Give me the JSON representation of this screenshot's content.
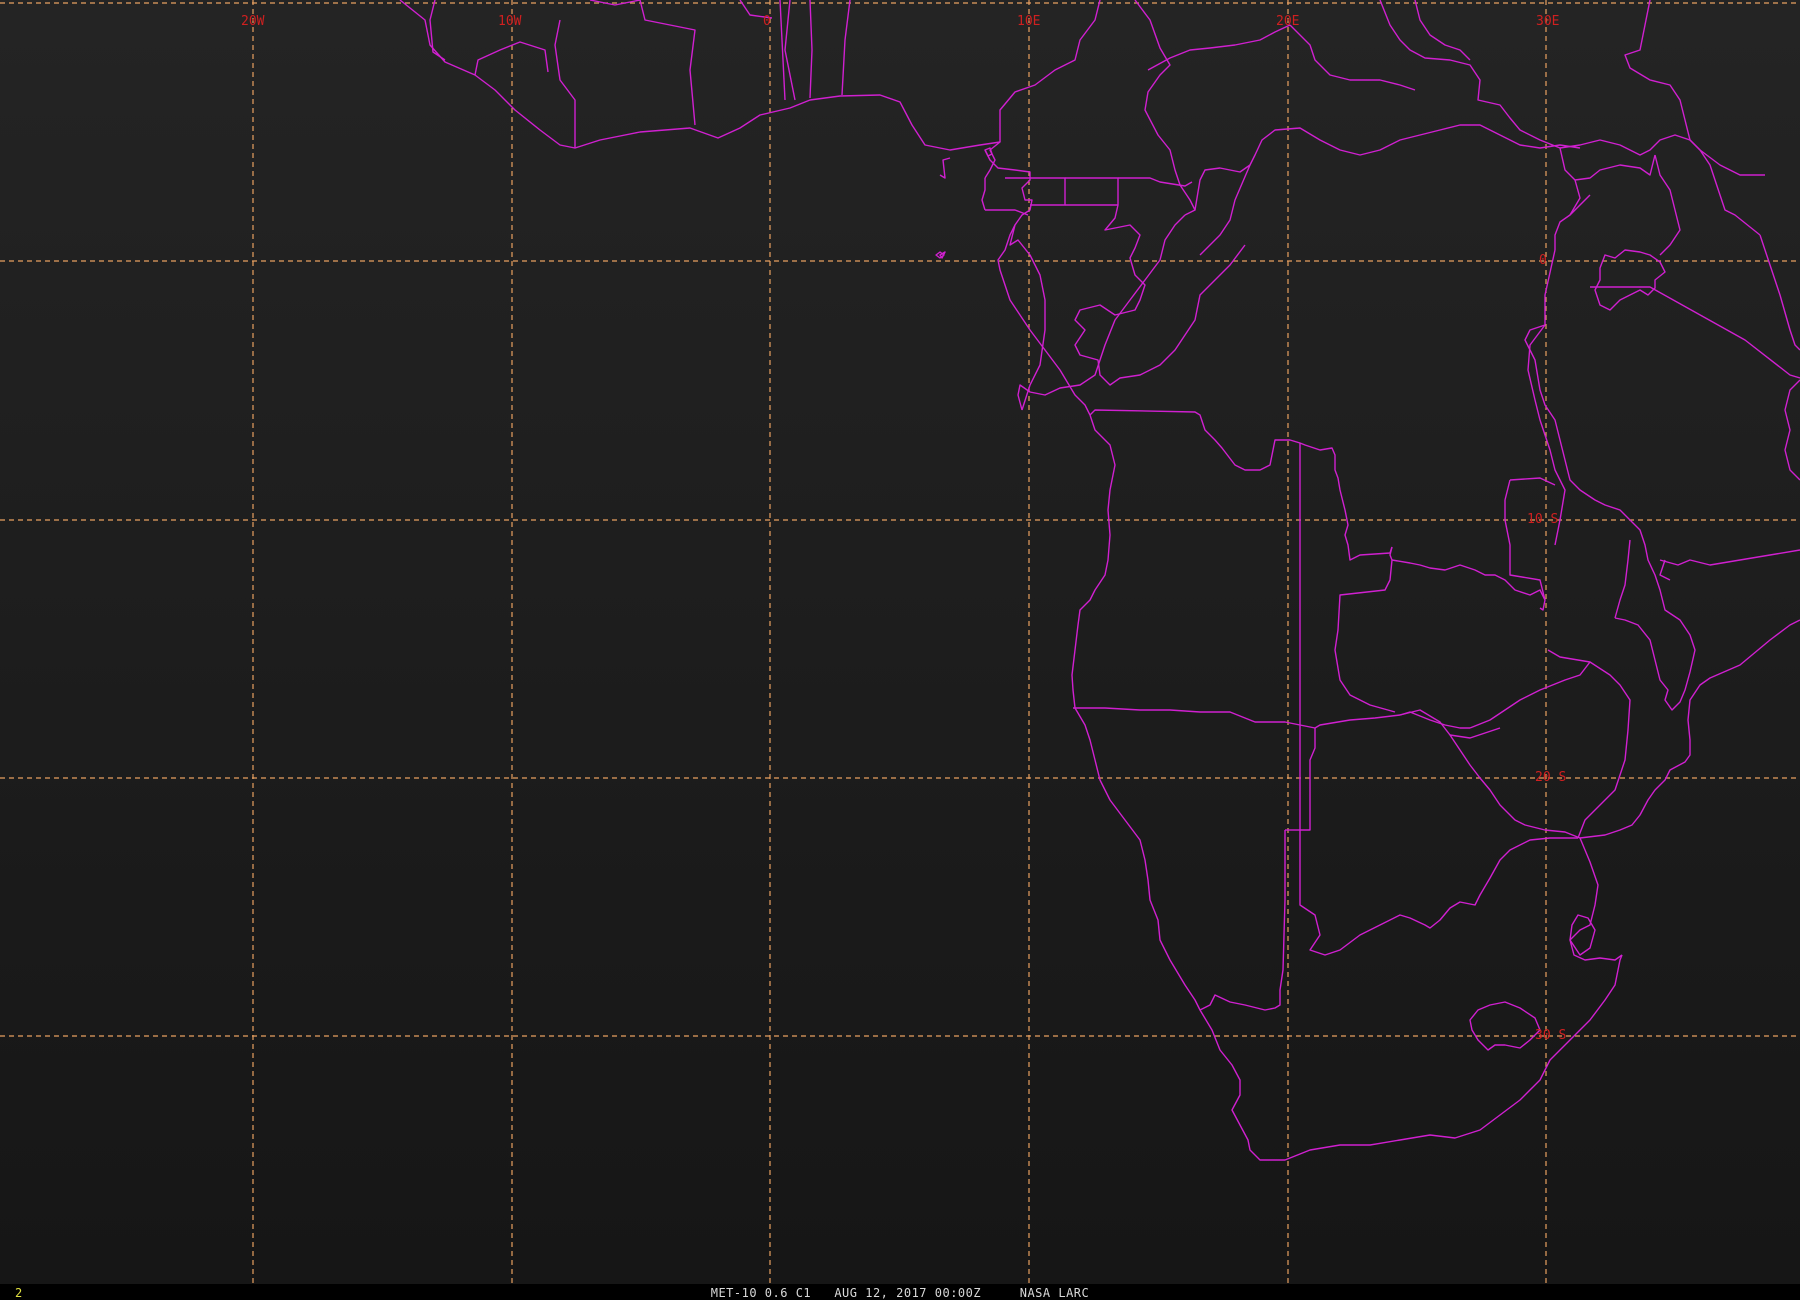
{
  "map": {
    "colors": {
      "background": "#1e1e1e",
      "grid": "#e8a060",
      "borders": "#d020d0",
      "labels": "#d02020"
    },
    "longitude_labels": [
      "20W",
      "10W",
      "0",
      "10E",
      "20E",
      "30E"
    ],
    "latitude_labels": [
      "0",
      "10 S",
      "20 S",
      "30 S"
    ]
  },
  "status": {
    "frame": "2",
    "caption": "MET-10 0.6 C1   AUG 12, 2017 00:00Z     NASA LARC"
  }
}
